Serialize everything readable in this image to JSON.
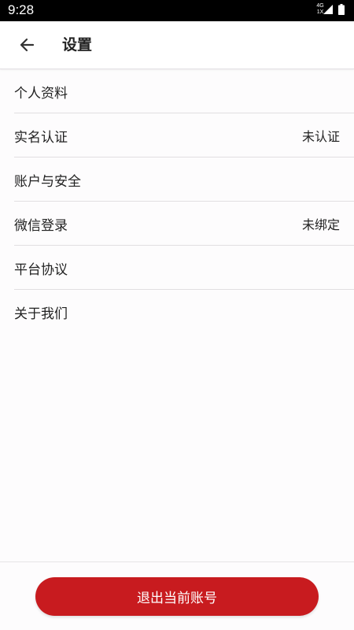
{
  "status_bar": {
    "time": "9:28",
    "network_top": "4G",
    "network_bottom": "1X"
  },
  "header": {
    "back_icon": "arrow-left-icon",
    "title": "设置"
  },
  "settings": {
    "items": [
      {
        "label": "个人资料",
        "value": ""
      },
      {
        "label": "实名认证",
        "value": "未认证"
      },
      {
        "label": "账户与安全",
        "value": ""
      },
      {
        "label": "微信登录",
        "value": "未绑定"
      },
      {
        "label": "平台协议",
        "value": ""
      },
      {
        "label": "关于我们",
        "value": ""
      }
    ]
  },
  "footer": {
    "logout_label": "退出当前账号"
  },
  "colors": {
    "accent": "#c81b1f",
    "background": "#fdfcfd",
    "status_bar": "#000000"
  }
}
